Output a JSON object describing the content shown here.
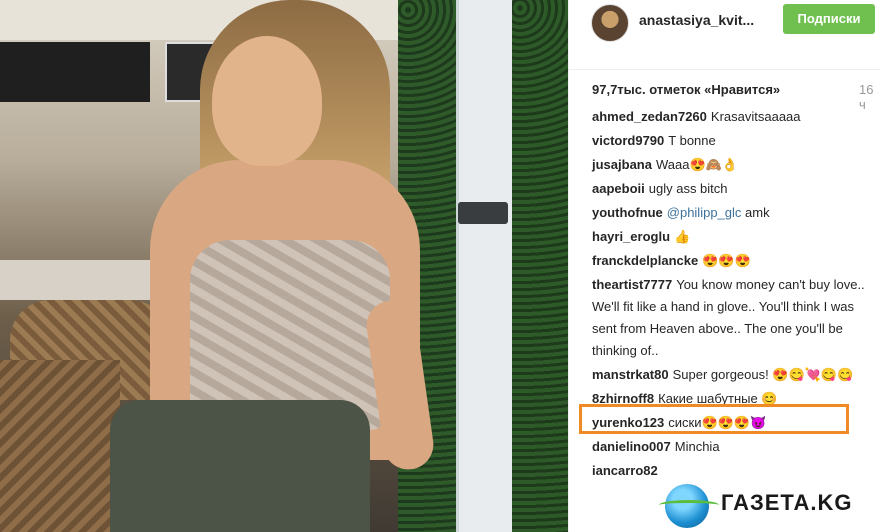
{
  "post": {
    "username": "anastasiya_kvit...",
    "follow_label": "Подписки",
    "likes": "97,7тыс. отметок «Нравится»",
    "time": "16 ч"
  },
  "comments": [
    {
      "user": "ahmed_zedan7260",
      "text": "Krasavitsaaaaa"
    },
    {
      "user": "victord9790",
      "text": "T bonne"
    },
    {
      "user": "jusajbana",
      "text": "Waaa😍🙈👌"
    },
    {
      "user": "aapeboii",
      "text": "ugly ass bitch"
    },
    {
      "user": "youthofnue",
      "mention": "@philipp_glc",
      "text": "amk"
    },
    {
      "user": "hayri_eroglu",
      "text": "👍"
    },
    {
      "user": "franckdelplancke",
      "text": "😍😍😍"
    },
    {
      "user": "theartist7777",
      "text": "You know money can't buy love.. We'll fit like a hand in glove.. You'll think I was sent from Heaven above.. The one you'll be thinking of.."
    },
    {
      "user": "manstrkat80",
      "text": "Super gorgeous! 😍😋💘😋😋"
    },
    {
      "user": "8zhirnoff8",
      "text": "Какие шабутные 😊"
    },
    {
      "user": "yurenko123",
      "text": "сиски😍😍😍😈"
    },
    {
      "user": "danielino007",
      "text": "Minchia"
    },
    {
      "user": "iancarro82",
      "text": ""
    }
  ],
  "watermark": {
    "text": "ГАЗЕТА.KG"
  },
  "colors": {
    "follow_bg": "#70c050",
    "highlight": "#f08a24",
    "mention": "#3f729b"
  }
}
